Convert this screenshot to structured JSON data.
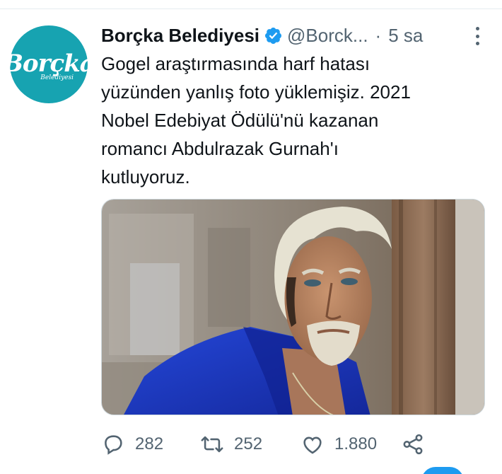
{
  "tweet": {
    "avatar": {
      "logo_text": "Borçka",
      "logo_subtext": "Belediyesi",
      "background": "#17a3b1"
    },
    "author": {
      "display_name": "Borçka Belediyesi",
      "handle": "@Borck...",
      "verified": true
    },
    "separator": "·",
    "time": "5 sa",
    "text_lines": [
      "Gogel araştırmasında harf hatası",
      "yüzünden yanlış foto yüklemişiz. 2021",
      "Nobel Edebiyat Ödülü'nü kazanan",
      "romancı Abdulrazak Gurnah'ı",
      "kutluyoruz."
    ],
    "actions": {
      "reply_count": "282",
      "retweet_count": "252",
      "like_count": "1.880"
    }
  },
  "icons": [
    "verified-badge-icon",
    "more-icon",
    "reply-icon",
    "retweet-icon",
    "like-icon",
    "share-icon"
  ],
  "colors": {
    "accent": "#1d9bf0",
    "secondary_text": "#536471",
    "jacket_blue": "#1e3fc7"
  }
}
